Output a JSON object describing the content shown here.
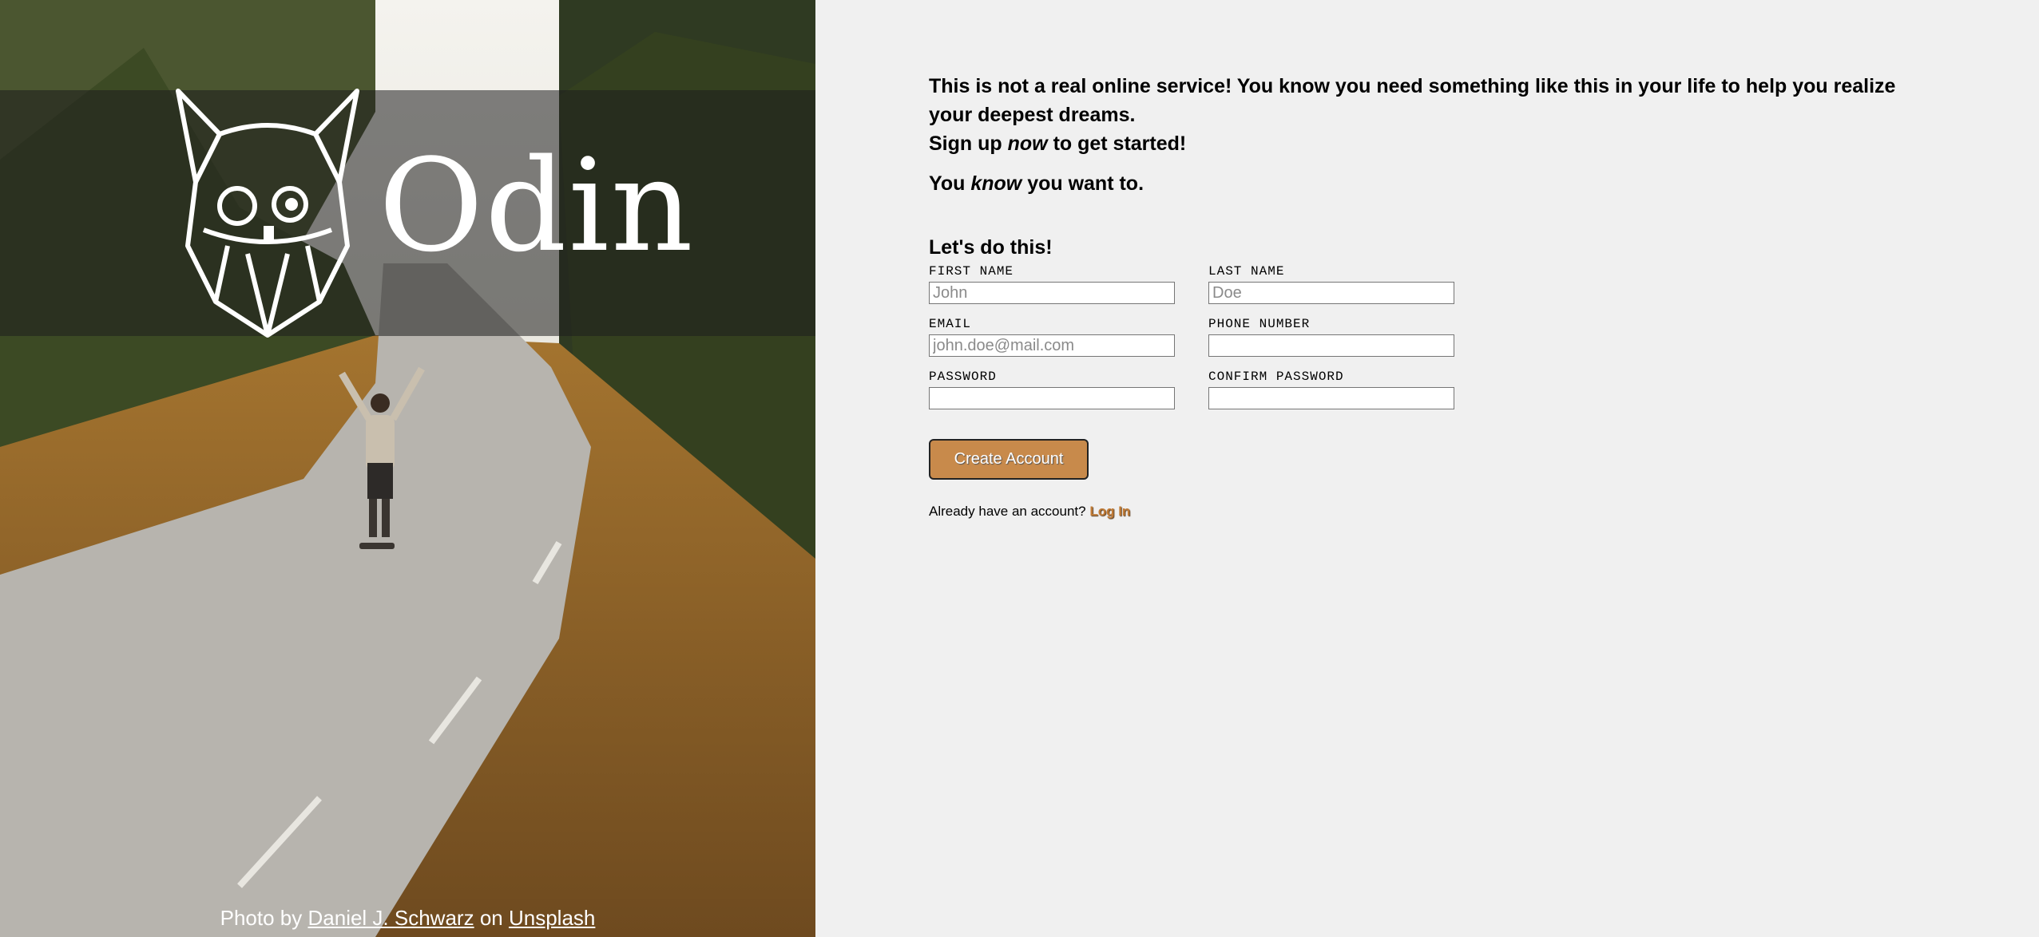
{
  "hero": {
    "logo_text": "Odin",
    "photo_credit": {
      "prefix": "Photo by",
      "author": "Daniel J. Schwarz",
      "middle": "on",
      "site": "Unsplash"
    }
  },
  "intro": {
    "line1": "This is not a real online service! You know you need something like this in your life to help you realize your deepest dreams.",
    "line2_pre": "Sign up",
    "line2_em": "now",
    "line2_post": "to get started!",
    "line3_pre": "You",
    "line3_em": "know",
    "line3_post": "you want to."
  },
  "form": {
    "title": "Let's do this!",
    "fields": {
      "first_name": {
        "label": "FIRST NAME",
        "placeholder": "John",
        "value": ""
      },
      "last_name": {
        "label": "LAST NAME",
        "placeholder": "Doe",
        "value": ""
      },
      "email": {
        "label": "EMAIL",
        "placeholder": "john.doe@mail.com",
        "value": ""
      },
      "phone": {
        "label": "PHONE NUMBER",
        "placeholder": "",
        "value": ""
      },
      "password": {
        "label": "PASSWORD",
        "placeholder": "",
        "value": ""
      },
      "confirm_password": {
        "label": "CONFIRM PASSWORD",
        "placeholder": "",
        "value": ""
      }
    },
    "submit_label": "Create Account",
    "login_prompt": "Already have an account?",
    "login_link": "Log In"
  },
  "colors": {
    "accent": "#c88a4b",
    "page_bg": "#f0f0f0",
    "link": "#c07a35"
  },
  "icons": {
    "logo": "odin-viking-head-icon"
  }
}
